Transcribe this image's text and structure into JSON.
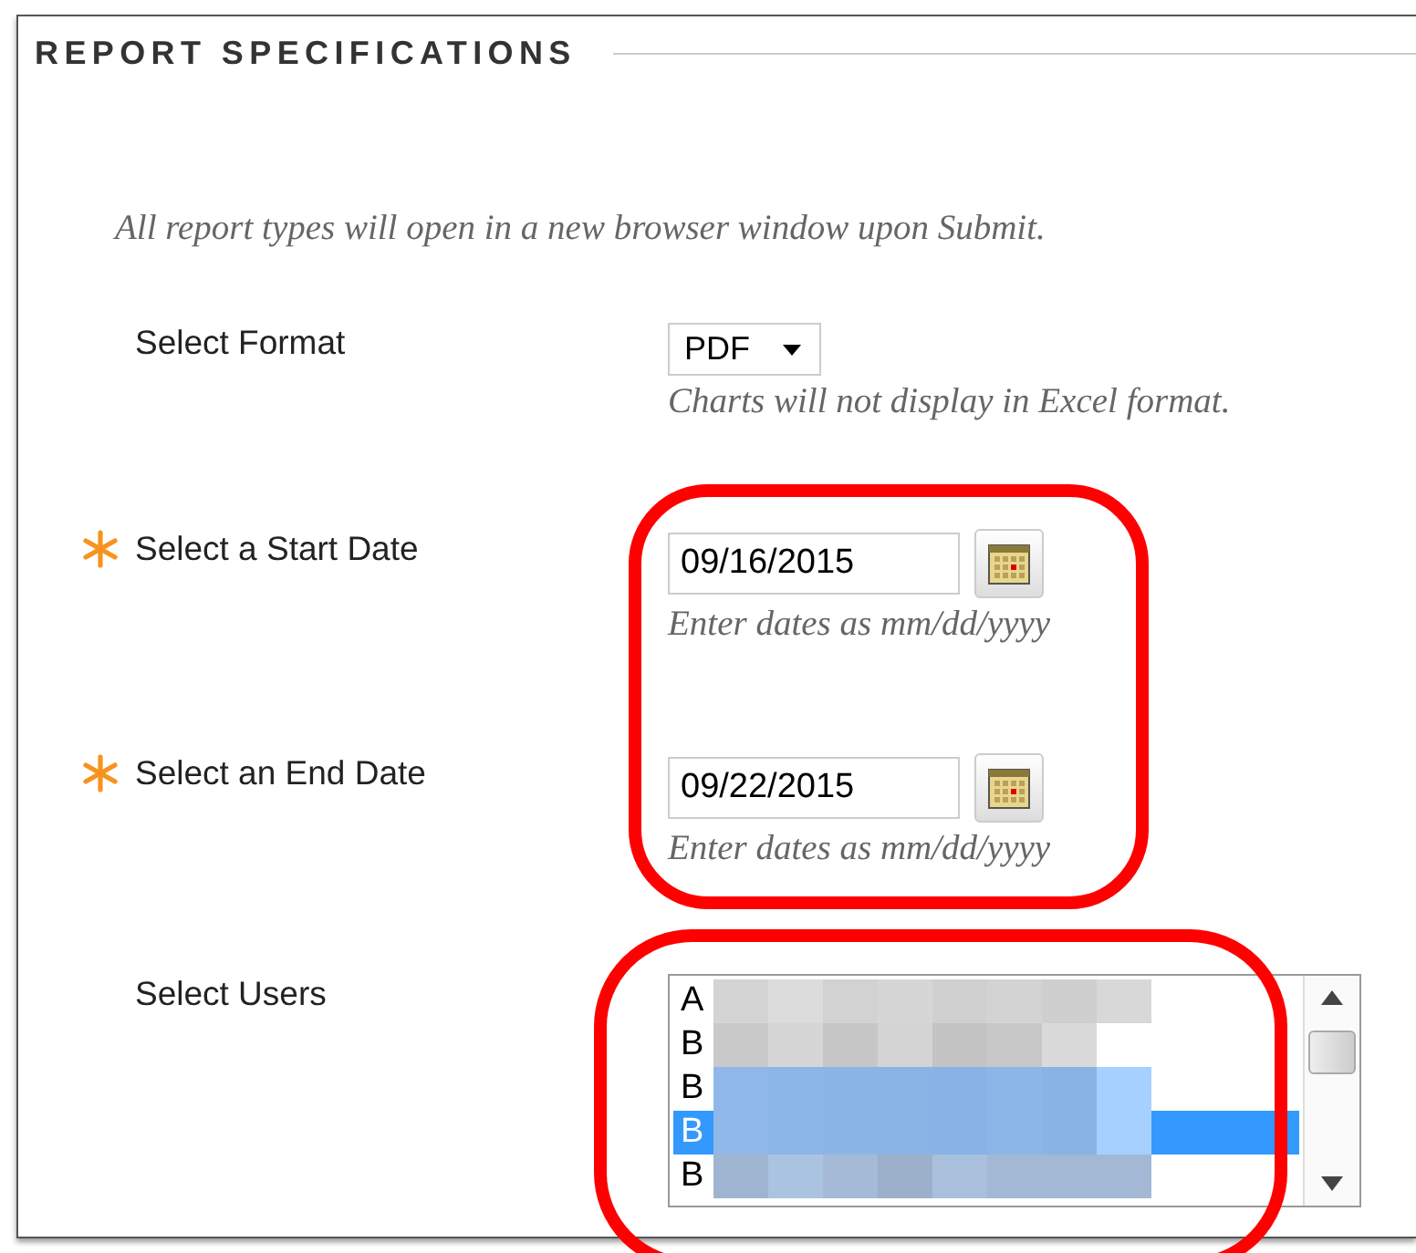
{
  "section": {
    "title": "REPORT SPECIFICATIONS"
  },
  "note": "All report types will open in a new browser window upon Submit.",
  "format": {
    "label": "Select Format",
    "value": "PDF",
    "hint": "Charts will not display in Excel format."
  },
  "start_date": {
    "label": "Select a Start Date",
    "required": true,
    "value": "09/16/2015",
    "hint": "Enter dates as mm/dd/yyyy"
  },
  "end_date": {
    "label": "Select an End Date",
    "required": true,
    "value": "09/22/2015",
    "hint": "Enter dates as mm/dd/yyyy"
  },
  "users": {
    "label": "Select Users",
    "items": [
      {
        "text": "A",
        "selected": false
      },
      {
        "text": "B",
        "selected": false
      },
      {
        "text": "B",
        "selected": false
      },
      {
        "text": "B",
        "selected": true
      },
      {
        "text": "B",
        "selected": false
      }
    ]
  }
}
